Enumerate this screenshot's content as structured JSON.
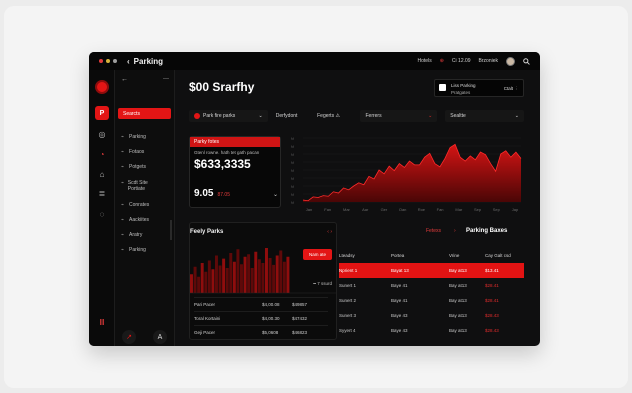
{
  "window": {
    "back_glyph": "‹",
    "title": "Parking",
    "dot_colors": [
      "#e23b3b",
      "#d7b33a",
      "#9d9d9d"
    ],
    "top_links": [
      "Hotels",
      "⊕",
      "Ci 12.09",
      "Brzoniek"
    ]
  },
  "rail": {
    "items": [
      "◎",
      "◔",
      "⌂",
      "≣",
      "◌",
      "Ⅲ"
    ]
  },
  "sidebar": {
    "arrow_left": "←",
    "arrow_right": "—",
    "search_label": "Searcts",
    "items": [
      {
        "label": "Parking",
        "icon": "⌁"
      },
      {
        "label": "Fotaos",
        "icon": "⌁"
      },
      {
        "label": "Potgets",
        "icon": "⌁"
      },
      {
        "label": "Scdt Site Portiate",
        "icon": "⌁"
      },
      {
        "label": "Conrates",
        "icon": "⌁"
      },
      {
        "label": "Aackiites",
        "icon": "⌁"
      },
      {
        "label": "Aratry",
        "icon": "⌁"
      },
      {
        "label": "Parking",
        "icon": "⌁"
      }
    ],
    "bottom_left": "↗",
    "bottom_right": "A"
  },
  "header": {
    "balance": "$00 Srarfhy",
    "notice_line1": "Liss Parking",
    "notice_line2": "Pratgates",
    "notice_right": "Ctalt"
  },
  "filters": [
    {
      "label": "Park fire parks",
      "caret": "⌄"
    },
    {
      "label": "Derfydont",
      "caret": ""
    },
    {
      "label": "Fegerts ⚠",
      "caret": ""
    },
    {
      "label": "Ferrers",
      "caret": "⌄"
    },
    {
      "label": "Sealtte",
      "caret": "⌄"
    }
  ],
  "stats_card": {
    "header": "Parky fotes",
    "sub": "Gtenl rowne. hath tet gath pacan",
    "amount": "$633,3335",
    "value": "9.05",
    "value_note": "87.05",
    "caret": "⌄"
  },
  "chart_data": {
    "type": "area",
    "series": [
      {
        "values": [
          3,
          2,
          8,
          7,
          10,
          9,
          16,
          14,
          22,
          19,
          25,
          30,
          27,
          40,
          36,
          50,
          44,
          56,
          49,
          60,
          54,
          64,
          58,
          58,
          70,
          76,
          60,
          55,
          68,
          85,
          90,
          70,
          64,
          72,
          66,
          78,
          74,
          60,
          48,
          75,
          80,
          70,
          78,
          68
        ]
      }
    ],
    "ylim": [
      0,
      100
    ],
    "y_ticks": [
      "ω",
      "ω",
      "ω",
      "ω",
      "ω",
      "ω",
      "ω",
      "ω",
      "ω"
    ],
    "x_ticks": [
      "Jan",
      "Fan",
      "Mar",
      "Aar",
      "Ger",
      "Oan",
      "Roe",
      "Fan",
      "Mar",
      "Sep",
      "Sep",
      "Jap"
    ],
    "color": "#d41414"
  },
  "feely_panel": {
    "title": "Feely Parks",
    "arrows": "‹ ›",
    "chart_badge": "Nam ate",
    "legend": "━ 7 ssurd",
    "bars": [
      30,
      42,
      26,
      48,
      34,
      52,
      38,
      60,
      44,
      55,
      40,
      64,
      50,
      70,
      46,
      58,
      62,
      40,
      66,
      54,
      48,
      72,
      56,
      45,
      60,
      68,
      50,
      58
    ],
    "rows": [
      {
        "name": "Pari Pacer",
        "a": "$4,00.08",
        "b": "$49857"
      },
      {
        "name": "Toral Kortaini",
        "a": "$4,00.30",
        "b": "$47432"
      },
      {
        "name": "Geji Pacer",
        "a": "$5,0608",
        "b": "$46823"
      }
    ]
  },
  "parking_table": {
    "tab_left": "Fetexs",
    "tab_right": "Parking Baxes",
    "arrows": "‹ ›",
    "headers": [
      "Lteadsy",
      "Portea",
      "Vrine",
      "Cay Galt csd"
    ],
    "rows": [
      {
        "c1": "Nprient 1",
        "c2": "Bayat 13",
        "c3": "Bay at13",
        "c4": "$13.41",
        "highlight": true
      },
      {
        "c1": "Sunert 1",
        "c2": "Baye 41",
        "c3": "Bay at13",
        "c4": "$28.41",
        "highlight": false
      },
      {
        "c1": "Sunert 2",
        "c2": "Baye 41",
        "c3": "Bay at13",
        "c4": "$28.41",
        "highlight": false
      },
      {
        "c1": "Sunert 3",
        "c2": "Baye 43",
        "c3": "Bay at13",
        "c4": "$28.43",
        "highlight": false
      },
      {
        "c1": "Syyert 4",
        "c2": "Baye 43",
        "c3": "Bay at13",
        "c4": "$28.43",
        "highlight": false
      }
    ]
  }
}
